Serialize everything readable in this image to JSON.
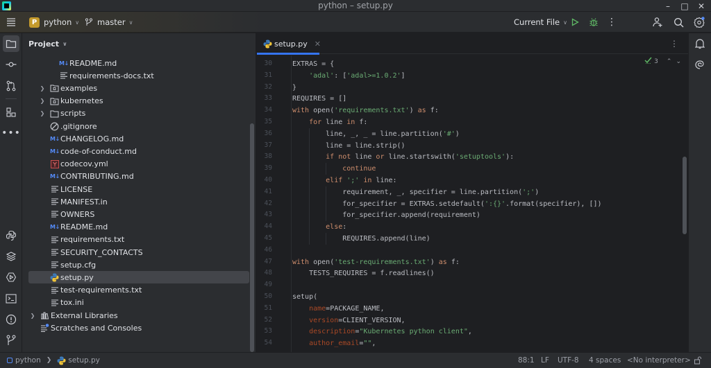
{
  "window": {
    "title": "python – setup.py",
    "controls": {
      "minimize": "minimize-icon",
      "maximize": "maximize-icon",
      "close": "close-icon"
    }
  },
  "toolbar": {
    "project_badge": "P",
    "project_name": "python",
    "branch_name": "master",
    "run_config": "Current File",
    "icons": [
      "hamburger-menu-icon",
      "git-branch-icon",
      "run-icon",
      "debug-icon",
      "more-vertical-icon",
      "add-user-icon",
      "search-icon",
      "settings-icon"
    ],
    "accent_color": "#3574f0",
    "run_color": "#5fb865"
  },
  "left_strip": {
    "top_icons": [
      "folder-icon",
      "commit-icon",
      "pull-requests-icon",
      "structure-icon",
      "more-horizontal-icon"
    ],
    "bottom_icons": [
      "python-console-icon",
      "layers-icon",
      "services-icon",
      "terminal-icon",
      "problems-icon",
      "git-icon"
    ]
  },
  "project_panel": {
    "title": "Project",
    "items": [
      {
        "label": "README.md",
        "icon": "markdown",
        "level": 3
      },
      {
        "label": "requirements-docs.txt",
        "icon": "text",
        "level": 3
      },
      {
        "label": "examples",
        "icon": "package-folder",
        "level": 2,
        "expandable": true
      },
      {
        "label": "kubernetes",
        "icon": "package-folder",
        "level": 2,
        "expandable": true
      },
      {
        "label": "scripts",
        "icon": "folder",
        "level": 2,
        "expandable": true
      },
      {
        "label": ".gitignore",
        "icon": "ignore",
        "level": 2
      },
      {
        "label": "CHANGELOG.md",
        "icon": "markdown",
        "level": 2
      },
      {
        "label": "code-of-conduct.md",
        "icon": "markdown",
        "level": 2
      },
      {
        "label": "codecov.yml",
        "icon": "yaml",
        "level": 2
      },
      {
        "label": "CONTRIBUTING.md",
        "icon": "markdown",
        "level": 2
      },
      {
        "label": "LICENSE",
        "icon": "text",
        "level": 2
      },
      {
        "label": "MANIFEST.in",
        "icon": "text",
        "level": 2
      },
      {
        "label": "OWNERS",
        "icon": "text",
        "level": 2
      },
      {
        "label": "README.md",
        "icon": "markdown",
        "level": 2
      },
      {
        "label": "requirements.txt",
        "icon": "text",
        "level": 2
      },
      {
        "label": "SECURITY_CONTACTS",
        "icon": "text",
        "level": 2
      },
      {
        "label": "setup.cfg",
        "icon": "text",
        "level": 2
      },
      {
        "label": "setup.py",
        "icon": "python",
        "level": 2,
        "selected": true
      },
      {
        "label": "test-requirements.txt",
        "icon": "text",
        "level": 2
      },
      {
        "label": "tox.ini",
        "icon": "text",
        "level": 2
      },
      {
        "label": "External Libraries",
        "icon": "library",
        "level": 1,
        "expandable": true
      },
      {
        "label": "Scratches and Consoles",
        "icon": "scratches",
        "level": 1
      }
    ]
  },
  "editor": {
    "tab": {
      "label": "setup.py",
      "icon": "python-file-icon"
    },
    "inspection": {
      "count": "3",
      "icon": "check-icon"
    },
    "lines": [
      {
        "n": "30",
        "indent": 0,
        "tokens": [
          [
            "t",
            "EXTRAS = {"
          ]
        ]
      },
      {
        "n": "31",
        "indent": 1,
        "tokens": [
          [
            "s",
            "'adal'"
          ],
          [
            "t",
            ": ["
          ],
          [
            "s",
            "'adal>=1.0.2'"
          ],
          [
            "t",
            "]"
          ]
        ]
      },
      {
        "n": "32",
        "indent": 0,
        "tokens": [
          [
            "t",
            "}"
          ]
        ]
      },
      {
        "n": "33",
        "indent": 0,
        "tokens": [
          [
            "t",
            "REQUIRES = []"
          ]
        ]
      },
      {
        "n": "34",
        "indent": 0,
        "tokens": [
          [
            "k",
            "with "
          ],
          [
            "t",
            "open("
          ],
          [
            "s",
            "'requirements.txt'"
          ],
          [
            "t",
            ") "
          ],
          [
            "k",
            "as "
          ],
          [
            "t",
            "f:"
          ]
        ]
      },
      {
        "n": "35",
        "indent": 1,
        "tokens": [
          [
            "k",
            "for "
          ],
          [
            "t",
            "line "
          ],
          [
            "k",
            "in "
          ],
          [
            "t",
            "f:"
          ]
        ]
      },
      {
        "n": "36",
        "indent": 2,
        "tokens": [
          [
            "t",
            "line, _, _ = line.partition("
          ],
          [
            "s",
            "'#'"
          ],
          [
            "t",
            ")"
          ]
        ]
      },
      {
        "n": "37",
        "indent": 2,
        "tokens": [
          [
            "t",
            "line = line.strip()"
          ]
        ]
      },
      {
        "n": "38",
        "indent": 2,
        "tokens": [
          [
            "k",
            "if not "
          ],
          [
            "t",
            "line "
          ],
          [
            "k",
            "or "
          ],
          [
            "t",
            "line.startswith("
          ],
          [
            "s",
            "'setuptools'"
          ],
          [
            "t",
            "):"
          ]
        ]
      },
      {
        "n": "39",
        "indent": 3,
        "tokens": [
          [
            "k",
            "continue"
          ]
        ]
      },
      {
        "n": "40",
        "indent": 2,
        "tokens": [
          [
            "k",
            "elif "
          ],
          [
            "s",
            "';' "
          ],
          [
            "k",
            "in "
          ],
          [
            "t",
            "line:"
          ]
        ]
      },
      {
        "n": "41",
        "indent": 3,
        "tokens": [
          [
            "t",
            "requirement, _, specifier = line.partition("
          ],
          [
            "s",
            "';'"
          ],
          [
            "t",
            ")"
          ]
        ]
      },
      {
        "n": "42",
        "indent": 3,
        "tokens": [
          [
            "t",
            "for_specifier = EXTRAS.setdefault("
          ],
          [
            "s",
            "':{}'"
          ],
          [
            "t",
            ".format(specifier), [])"
          ]
        ]
      },
      {
        "n": "43",
        "indent": 3,
        "tokens": [
          [
            "t",
            "for_specifier.append(requirement)"
          ]
        ]
      },
      {
        "n": "44",
        "indent": 2,
        "tokens": [
          [
            "k",
            "else"
          ],
          [
            "t",
            ":"
          ]
        ]
      },
      {
        "n": "45",
        "indent": 3,
        "tokens": [
          [
            "t",
            "REQUIRES.append(line)"
          ]
        ]
      },
      {
        "n": "46",
        "indent": 0,
        "tokens": []
      },
      {
        "n": "47",
        "indent": 0,
        "tokens": [
          [
            "k",
            "with "
          ],
          [
            "t",
            "open("
          ],
          [
            "s",
            "'test-requirements.txt'"
          ],
          [
            "t",
            ") "
          ],
          [
            "k",
            "as "
          ],
          [
            "t",
            "f:"
          ]
        ]
      },
      {
        "n": "48",
        "indent": 1,
        "tokens": [
          [
            "t",
            "TESTS_REQUIRES = f.readlines()"
          ]
        ]
      },
      {
        "n": "49",
        "indent": 0,
        "tokens": []
      },
      {
        "n": "50",
        "indent": 0,
        "tokens": [
          [
            "t",
            "setup("
          ]
        ]
      },
      {
        "n": "51",
        "indent": 1,
        "tokens": [
          [
            "a",
            "name"
          ],
          [
            "t",
            "=PACKAGE_NAME,"
          ]
        ]
      },
      {
        "n": "52",
        "indent": 1,
        "tokens": [
          [
            "a",
            "version"
          ],
          [
            "t",
            "=CLIENT_VERSION,"
          ]
        ]
      },
      {
        "n": "53",
        "indent": 1,
        "tokens": [
          [
            "a",
            "description"
          ],
          [
            "t",
            "="
          ],
          [
            "s",
            "\"Kubernetes python client\""
          ],
          [
            "t",
            ","
          ]
        ]
      },
      {
        "n": "54",
        "indent": 1,
        "tokens": [
          [
            "a",
            "author_email"
          ],
          [
            "t",
            "="
          ],
          [
            "s",
            "\"\""
          ],
          [
            "t",
            ","
          ]
        ]
      }
    ],
    "colors": {
      "keyword": "#cf8e6d",
      "string": "#6aab73",
      "kwarg": "#aa4926",
      "text": "#bcbec4"
    }
  },
  "right_strip": {
    "icons": [
      "notifications-icon",
      "ai-assistant-icon"
    ]
  },
  "status_bar": {
    "breadcrumb": [
      "python",
      "setup.py"
    ],
    "position": "88:1",
    "line_ending": "LF",
    "encoding": "UTF-8",
    "indent": "4 spaces",
    "interpreter": "<No interpreter>",
    "lock_icon": "unlock-icon"
  }
}
